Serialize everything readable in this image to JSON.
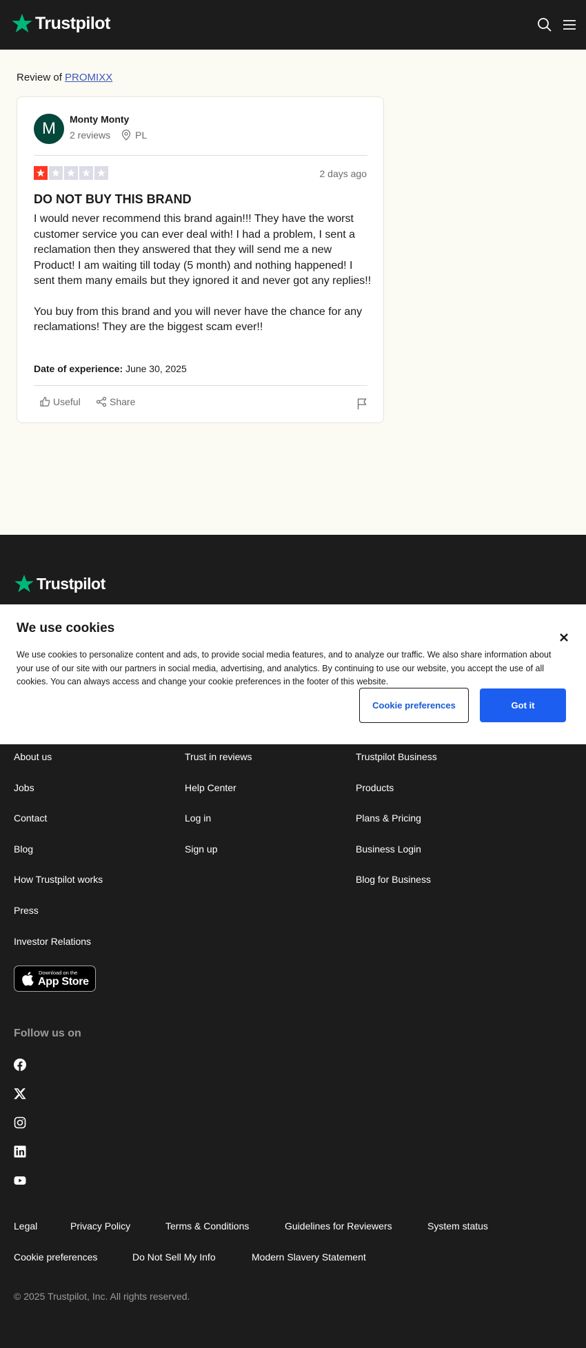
{
  "header": {
    "logo_text": "Trustpilot",
    "icons": [
      "search-icon",
      "menu-icon"
    ]
  },
  "review": {
    "review_of_prefix": "Review of",
    "business_name": "PROMIXX",
    "author": {
      "initial": "M",
      "name": "Monty Monty",
      "reviews_count": "2 reviews",
      "country": "PL",
      "avatar_color": "#04473b"
    },
    "rating": 1,
    "max_rating": 5,
    "posted": "2 days ago",
    "title": "DO NOT BUY THIS BRAND",
    "paragraphs": [
      "I would never recommend this brand again!!! They have the worst customer service you can ever deal with! I had a problem, I sent a reclamation then they answered that they will send me a new Product! I am waiting till today (5 month) and nothing happened! I sent them many emails but they ignored it and never got any replies!!",
      "You buy from this brand and you will never have the chance for any reclamations! They are the biggest scam ever!!"
    ],
    "date_of_experience_label": "Date of experience:",
    "date_of_experience": "June 30, 2025",
    "useful_label": "Useful",
    "share_label": "Share"
  },
  "cookie_banner": {
    "title": "We use cookies",
    "text": "We use cookies to personalize content and ads, to provide social media features, and to analyze our traffic. We also share information about your use of our site with our partners in social media, advertising, and analytics. By continuing to use our website, you accept the use of all cookies. You can always access and change your cookie preferences in the footer of this website.",
    "preferences_button": "Cookie preferences",
    "accept_button": "Got it"
  },
  "footer": {
    "logo_text": "Trustpilot",
    "col1": [
      "About us",
      "Jobs",
      "Contact",
      "Blog",
      "How Trustpilot works",
      "Press",
      "Investor Relations"
    ],
    "col2": [
      "Trust in reviews",
      "Help Center",
      "Log in",
      "Sign up"
    ],
    "col3": [
      "Trustpilot Business",
      "Products",
      "Plans & Pricing",
      "Business Login",
      "Blog for Business"
    ],
    "app_store_small": "Download on the",
    "app_store_big": "App Store",
    "follow_label": "Follow us on",
    "social_icons": [
      "facebook-icon",
      "x-icon",
      "instagram-icon",
      "linkedin-icon",
      "youtube-icon"
    ],
    "legal_row1": [
      "Legal",
      "Privacy Policy",
      "Terms & Conditions",
      "Guidelines for Reviewers",
      "System status"
    ],
    "legal_row2": [
      "Cookie preferences",
      "Do Not Sell My Info",
      "Modern Slavery Statement"
    ],
    "copyright": "© 2025 Trustpilot, Inc. All rights reserved."
  },
  "colors": {
    "brand_green": "#00b67a",
    "star_red": "#ff3722",
    "star_grey": "#dcdce6",
    "link_blue": "#3c57bc",
    "button_blue": "#1c5ff0"
  }
}
